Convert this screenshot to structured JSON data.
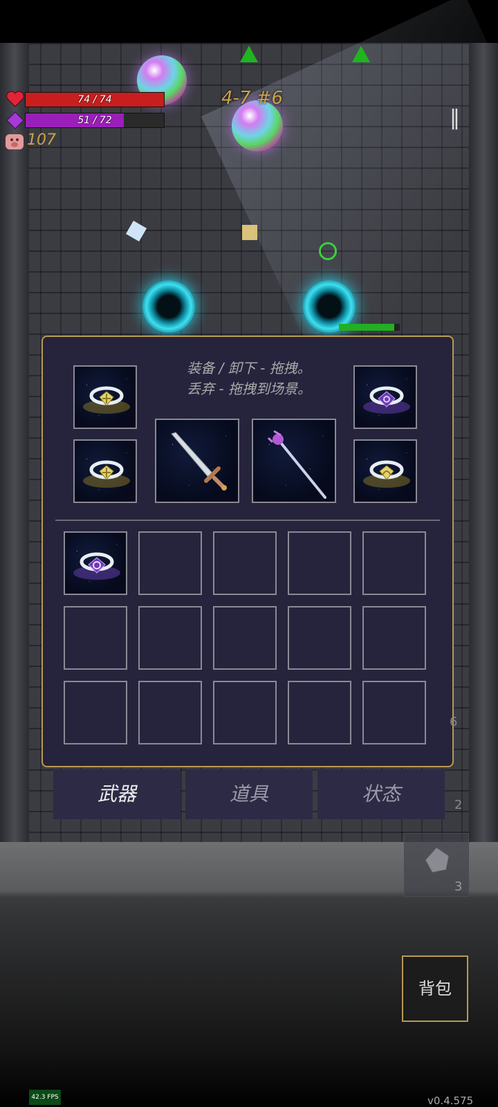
{
  "hud": {
    "hp_text": "74 / 74",
    "hp_fraction": 1.0,
    "mp_text": "51 / 72",
    "mp_fraction": 0.708,
    "coins": "107",
    "level": "4-7 #6",
    "pause_icon": "pause-icon"
  },
  "inventory": {
    "hint_line1": "装备 / 卸下 - 拖拽。",
    "hint_line2": "丢弃 - 拖拽到场景。",
    "equipped": [
      {
        "slot": "ring-top-left",
        "icon": "gold-cross-ring-icon"
      },
      {
        "slot": "ring-bottom-left",
        "icon": "gold-cross-ring-icon"
      },
      {
        "slot": "weapon-main",
        "icon": "sword-icon"
      },
      {
        "slot": "weapon-off",
        "icon": "staff-icon"
      },
      {
        "slot": "ring-top-right",
        "icon": "purple-swirl-ring-icon"
      },
      {
        "slot": "ring-bottom-right",
        "icon": "gold-lotus-ring-icon"
      }
    ],
    "bag": [
      {
        "icon": "purple-flower-ring-icon"
      }
    ],
    "bag_slots": 15
  },
  "tabs": [
    {
      "label": "武器",
      "active": true
    },
    {
      "label": "道具",
      "active": false
    },
    {
      "label": "状态",
      "active": false
    }
  ],
  "side_counts": [
    "6",
    "2",
    "3"
  ],
  "backpack_label": "背包",
  "fps": "42.3 FPS",
  "version": "v0.4.575",
  "colors": {
    "hp": "#c81e1e",
    "mp": "#9a1fb8",
    "gold": "#c9a24a",
    "panel": "#26243c",
    "border": "#b89a52"
  }
}
